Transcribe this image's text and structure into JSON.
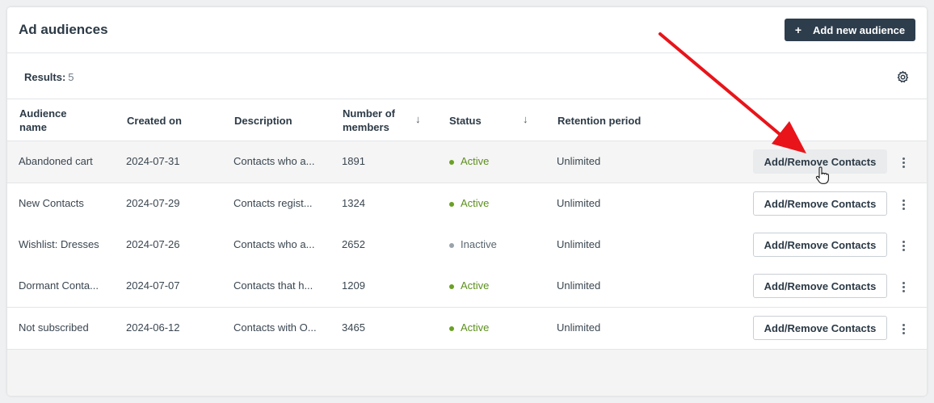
{
  "header": {
    "title": "Ad audiences",
    "add_button_icon": "+",
    "add_button_label": "Add new audience"
  },
  "results": {
    "label": "Results:",
    "count": "5",
    "settings_icon": "gear-icon"
  },
  "table": {
    "columns": {
      "name": "Audience name",
      "created": "Created on",
      "description": "Description",
      "members": "Number of members",
      "status": "Status",
      "retention": "Retention period"
    },
    "sort_icon": "↓",
    "rows": [
      {
        "name": "Abandoned cart",
        "created": "2024-07-31",
        "description": "Contacts who a...",
        "members": "1891",
        "status": "Active",
        "retention": "Unlimited",
        "action": "Add/Remove Contacts"
      },
      {
        "name": "New Contacts",
        "created": "2024-07-29",
        "description": "Contacts regist...",
        "members": "1324",
        "status": "Active",
        "retention": "Unlimited",
        "action": "Add/Remove Contacts"
      },
      {
        "name": "Wishlist: Dresses",
        "created": "2024-07-26",
        "description": "Contacts who a...",
        "members": "2652",
        "status": "Inactive",
        "retention": "Unlimited",
        "action": "Add/Remove Contacts"
      },
      {
        "name": "Dormant Conta...",
        "created": "2024-07-07",
        "description": "Contacts that h...",
        "members": "1209",
        "status": "Active",
        "retention": "Unlimited",
        "action": "Add/Remove Contacts"
      },
      {
        "name": "Not subscribed",
        "created": "2024-06-12",
        "description": "Contacts with O...",
        "members": "3465",
        "status": "Active",
        "retention": "Unlimited",
        "action": "Add/Remove Contacts"
      }
    ]
  },
  "colors": {
    "active": "#6aa024",
    "inactive": "#9aa3aa",
    "annotation_arrow": "#e8141a",
    "primary_button": "#2e3d4c"
  }
}
